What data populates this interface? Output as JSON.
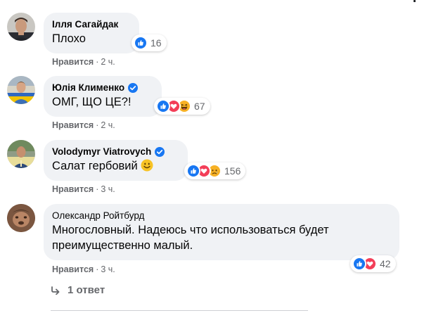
{
  "comments": [
    {
      "author": "Ілля Сагайдак",
      "verified": false,
      "text": "Плохо",
      "reactions": [
        "like"
      ],
      "reaction_count": "16",
      "like_label": "Нравится",
      "separator": "·",
      "time": "2 ч."
    },
    {
      "author": "Юлія Клименко",
      "verified": true,
      "text": "ОМГ, ЩО ЦЕ?!",
      "reactions": [
        "like",
        "love",
        "haha"
      ],
      "reaction_count": "67",
      "like_label": "Нравится",
      "separator": "·",
      "time": "2 ч."
    },
    {
      "author": "Volodymyr Viatrovych",
      "verified": true,
      "text": "Салат гербовий",
      "text_emoji": "smile",
      "reactions": [
        "like",
        "love",
        "sad"
      ],
      "reaction_count": "156",
      "like_label": "Нравится",
      "separator": "·",
      "time": "3 ч."
    },
    {
      "author": "Олександр Ройтбурд",
      "verified": false,
      "text_line1": "Многословный. Надеюсь что использоваться будет",
      "text_line2": "преимущественно малый.",
      "reactions": [
        "like",
        "love"
      ],
      "reaction_count": "42",
      "like_label": "Нравится",
      "separator": "·",
      "time": "3 ч."
    }
  ],
  "replies_link": "1 ответ",
  "colors": {
    "bubble": "#f0f2f5",
    "meta_text": "#65676b",
    "like_blue": "#1877f2",
    "love_red": "#f33e58",
    "emoji_yellow": "#f7b125",
    "verified_blue": "#1877f2"
  }
}
